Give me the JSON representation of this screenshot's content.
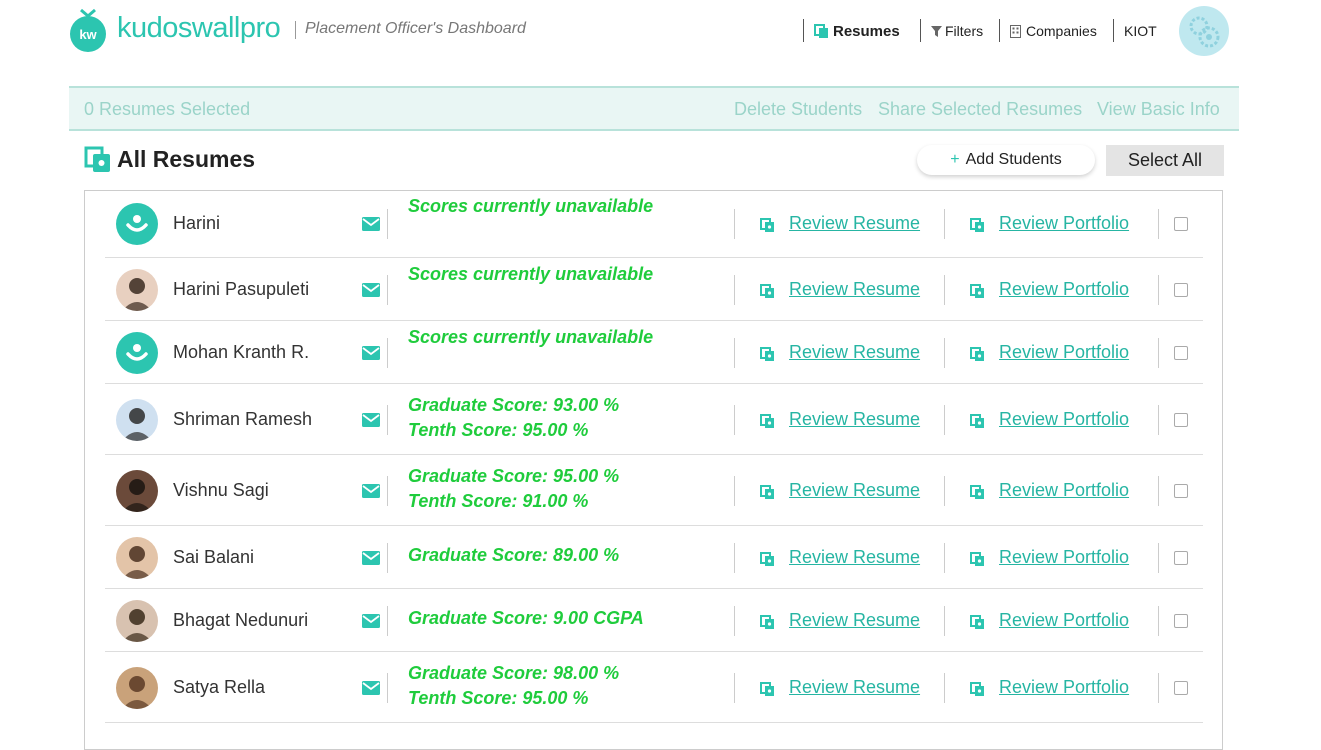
{
  "brand": {
    "logo_mark": "kw",
    "name": "kudoswallpro",
    "page_title": "Placement Officer's Dashboard"
  },
  "nav": [
    {
      "label": "Resumes",
      "icon": "resumes-icon",
      "active": true
    },
    {
      "label": "Filters",
      "icon": "filter-icon"
    },
    {
      "label": "Companies",
      "icon": "building-icon"
    },
    {
      "label": "KIOT"
    }
  ],
  "selection_bar": {
    "count_label": "0 Resumes Selected",
    "actions": [
      "Delete Students",
      "Share Selected Resumes",
      "View Basic Info"
    ]
  },
  "section": {
    "title": "All Resumes",
    "add_label": "Add Students",
    "add_plus": "+",
    "select_all_label": "Select All"
  },
  "links": {
    "review_resume": "Review Resume",
    "review_portfolio": "Review Portfolio"
  },
  "students": [
    {
      "name": "Harini",
      "avatar": "default",
      "scores": [
        "Scores currently unavailable"
      ]
    },
    {
      "name": "Harini Pasupuleti",
      "avatar": "photo",
      "scores": [
        "Scores currently unavailable"
      ]
    },
    {
      "name": "Mohan Kranth R.",
      "avatar": "default",
      "scores": [
        "Scores currently unavailable"
      ]
    },
    {
      "name": "Shriman Ramesh",
      "avatar": "photo",
      "scores": [
        "Graduate Score: 93.00 %",
        "Tenth Score: 95.00 %"
      ]
    },
    {
      "name": "Vishnu Sagi",
      "avatar": "photo",
      "scores": [
        "Graduate Score: 95.00 %",
        "Tenth Score: 91.00 %"
      ]
    },
    {
      "name": "Sai Balani",
      "avatar": "photo",
      "scores": [
        "Graduate Score: 89.00 %"
      ]
    },
    {
      "name": "Bhagat Nedunuri",
      "avatar": "photo",
      "scores": [
        "Graduate Score: 9.00 CGPA"
      ]
    },
    {
      "name": "Satya Rella",
      "avatar": "photo",
      "scores": [
        "Graduate Score: 98.00 %",
        "Tenth Score: 95.00 %"
      ]
    }
  ],
  "colors": {
    "accent": "#2cc5b0",
    "score_green": "#1fcc3c",
    "link": "#26b5a3",
    "selbar_bg": "#e9f6f4"
  }
}
